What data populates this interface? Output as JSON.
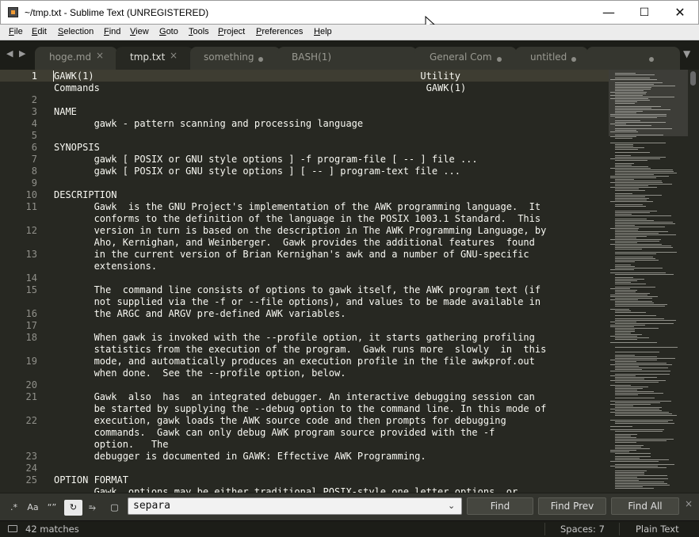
{
  "window": {
    "title": "~/tmp.txt - Sublime Text (UNREGISTERED)",
    "minimize": "—",
    "maximize": "☐",
    "close": "✕"
  },
  "menu": [
    "File",
    "Edit",
    "Selection",
    "Find",
    "View",
    "Goto",
    "Tools",
    "Project",
    "Preferences",
    "Help"
  ],
  "tabs": [
    {
      "label": "hoge.md",
      "state": "close"
    },
    {
      "label": "tmp.txt",
      "state": "close"
    },
    {
      "label": "something",
      "state": "dirty"
    },
    {
      "label": "BASH(1)",
      "state": "none"
    },
    {
      "label": "General Com",
      "state": "dirty"
    },
    {
      "label": "untitled",
      "state": "dirty"
    },
    {
      "label": "",
      "state": "dirty"
    }
  ],
  "tab_nav": {
    "prev": "◀",
    "next": "▶",
    "more": "▼",
    "close_glyph": "×"
  },
  "editor": {
    "rows": [
      {
        "ln": "1",
        "text": "GAWK(1)                                                         Utility"
      },
      {
        "ln": "",
        "text": "Commands                                                         GAWK(1)"
      },
      {
        "ln": "2",
        "text": ""
      },
      {
        "ln": "3",
        "text": "NAME"
      },
      {
        "ln": "4",
        "text": "       gawk - pattern scanning and processing language"
      },
      {
        "ln": "5",
        "text": ""
      },
      {
        "ln": "6",
        "text": "SYNOPSIS"
      },
      {
        "ln": "7",
        "text": "       gawk [ POSIX or GNU style options ] -f program-file [ -- ] file ..."
      },
      {
        "ln": "8",
        "text": "       gawk [ POSIX or GNU style options ] [ -- ] program-text file ..."
      },
      {
        "ln": "9",
        "text": ""
      },
      {
        "ln": "10",
        "text": "DESCRIPTION"
      },
      {
        "ln": "11",
        "text": "       Gawk  is the GNU Project's implementation of the AWK programming language.  It"
      },
      {
        "ln": "",
        "text": "       conforms to the definition of the language in the POSIX 1003.1 Standard.  This"
      },
      {
        "ln": "12",
        "text": "       version in turn is based on the description in The AWK Programming Language, by"
      },
      {
        "ln": "",
        "text": "       Aho, Kernighan, and Weinberger.  Gawk provides the additional features  found"
      },
      {
        "ln": "13",
        "text": "       in the current version of Brian Kernighan's awk and a number of GNU-specific"
      },
      {
        "ln": "",
        "text": "       extensions."
      },
      {
        "ln": "14",
        "text": ""
      },
      {
        "ln": "15",
        "text": "       The  command line consists of options to gawk itself, the AWK program text (if"
      },
      {
        "ln": "",
        "text": "       not supplied via the -f or --file options), and values to be made available in"
      },
      {
        "ln": "16",
        "text": "       the ARGC and ARGV pre-defined AWK variables."
      },
      {
        "ln": "17",
        "text": ""
      },
      {
        "ln": "18",
        "text": "       When gawk is invoked with the --profile option, it starts gathering profiling"
      },
      {
        "ln": "",
        "text": "       statistics from the execution of the program.  Gawk runs more  slowly  in  this"
      },
      {
        "ln": "19",
        "text": "       mode, and automatically produces an execution profile in the file awkprof.out"
      },
      {
        "ln": "",
        "text": "       when done.  See the --profile option, below."
      },
      {
        "ln": "20",
        "text": ""
      },
      {
        "ln": "21",
        "text": "       Gawk  also  has  an integrated debugger. An interactive debugging session can"
      },
      {
        "ln": "",
        "text": "       be started by supplying the --debug option to the command line. In this mode of"
      },
      {
        "ln": "22",
        "text": "       execution, gawk loads the AWK source code and then prompts for debugging"
      },
      {
        "ln": "",
        "text": "       commands.  Gawk can only debug AWK program source provided with the -f"
      },
      {
        "ln": "",
        "text": "       option.   The"
      },
      {
        "ln": "23",
        "text": "       debugger is documented in GAWK: Effective AWK Programming."
      },
      {
        "ln": "24",
        "text": ""
      },
      {
        "ln": "25",
        "text": "OPTION FORMAT"
      },
      {
        "ln": "",
        "text": "       Gawk  options may be either traditional POSIX-style one letter options, or"
      }
    ]
  },
  "find": {
    "regex": ".*",
    "case": "Aa",
    "whole_word": "“”",
    "wrap": "↻",
    "in_selection": "⥱",
    "highlight": "▢",
    "query": "separa",
    "dropdown": "⌄",
    "find_btn": "Find",
    "find_prev_btn": "Find Prev",
    "find_all_btn": "Find All",
    "close": "×"
  },
  "status": {
    "matches": "42 matches",
    "spaces": "Spaces: 7",
    "syntax": "Plain Text"
  },
  "colors": {
    "bg": "#272822",
    "fg": "#f8f8f2",
    "gutter_fg": "#90908a",
    "tabbar": "#1c1d18"
  }
}
